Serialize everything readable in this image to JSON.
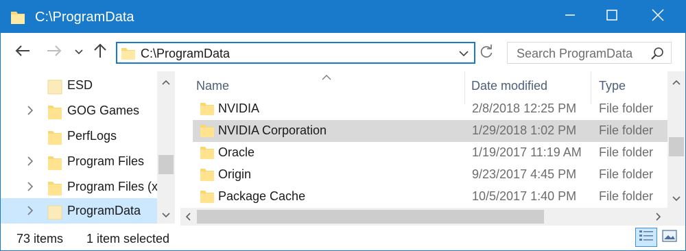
{
  "window": {
    "title": "C:\\ProgramData",
    "accent_color": "#1979ca",
    "icons": {
      "app": "folder-icon",
      "minimize": "minimize-icon",
      "maximize": "maximize-icon",
      "close": "close-icon"
    }
  },
  "navigation": {
    "back_icon": "arrow-left-icon",
    "forward_icon": "arrow-right-icon",
    "recent_icon": "chevron-down-icon",
    "up_icon": "arrow-up-icon",
    "address_path": "C:\\ProgramData",
    "refresh_icon": "refresh-icon",
    "search_placeholder": "Search ProgramData"
  },
  "nav_pane": {
    "items": [
      {
        "label": "ESD",
        "expandable": false,
        "selected": false
      },
      {
        "label": "GOG Games",
        "expandable": true,
        "selected": false
      },
      {
        "label": "PerfLogs",
        "expandable": false,
        "selected": false
      },
      {
        "label": "Program Files",
        "expandable": true,
        "selected": false
      },
      {
        "label": "Program Files (x",
        "expandable": true,
        "selected": false
      },
      {
        "label": "ProgramData",
        "expandable": true,
        "selected": true
      }
    ]
  },
  "file_list": {
    "columns": {
      "name": "Name",
      "date": "Date modified",
      "type": "Type"
    },
    "sort_column": "Name",
    "rows": [
      {
        "name": "NVIDIA",
        "date": "2/8/2018 12:25 PM",
        "type": "File folder",
        "highlighted": false
      },
      {
        "name": "NVIDIA Corporation",
        "date": "1/29/2018 1:02 PM",
        "type": "File folder",
        "highlighted": true
      },
      {
        "name": "Oracle",
        "date": "1/19/2017 11:19 AM",
        "type": "File folder",
        "highlighted": false
      },
      {
        "name": "Origin",
        "date": "9/23/2017 4:45 PM",
        "type": "File folder",
        "highlighted": false
      },
      {
        "name": "Package Cache",
        "date": "10/5/2017 1:40 PM",
        "type": "File folder",
        "highlighted": false
      }
    ]
  },
  "status_bar": {
    "item_count": "73 items",
    "selection": "1 item selected",
    "view_details_icon": "details-view-icon",
    "view_tiles_icon": "large-icons-view-icon"
  }
}
